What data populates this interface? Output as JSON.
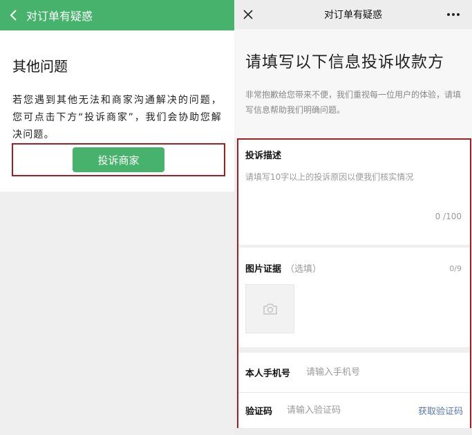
{
  "left": {
    "header_title": "对订单有疑惑",
    "heading": "其他问题",
    "description": "若您遇到其他无法和商家沟通解决的问题，您可点击下方“投诉商家”，我们会协助您解决问题。",
    "complain_button": "投诉商家"
  },
  "right": {
    "header_title": "对订单有疑惑",
    "intro_title": "请填写以下信息投诉收款方",
    "intro_desc": "非常抱歉给您带来不便，我们重视每一位用户的体验，请填写信息帮助我们明确问题。",
    "description_label": "投诉描述",
    "description_placeholder": "请填写10字以上的投诉原因以便我们核实情况",
    "char_count": "0 /100",
    "image_label": "图片证据",
    "image_optional": "（选填）",
    "image_count": "0/9",
    "phone_label": "本人手机号",
    "phone_placeholder": "请输入手机号",
    "code_label": "验证码",
    "code_placeholder": "请输入验证码",
    "get_code": "获取验证码"
  },
  "colors": {
    "green": "#47b26b",
    "highlight_border": "#a31d22",
    "link": "#5878a8"
  },
  "icons": {
    "back": "chevron-left-icon",
    "close": "close-icon",
    "more": "more-dots-icon",
    "camera": "camera-icon"
  }
}
